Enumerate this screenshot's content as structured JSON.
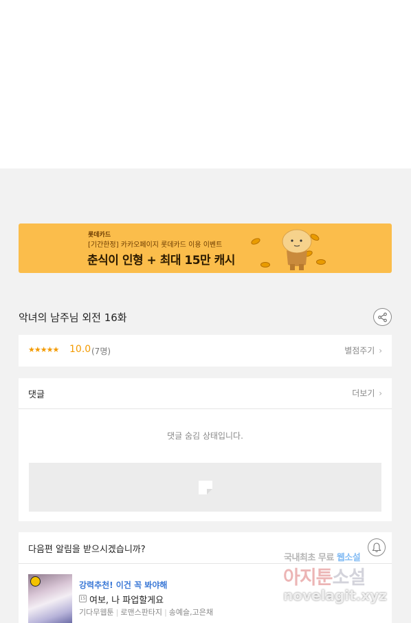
{
  "banner": {
    "brand": "롯데카드",
    "sub": "[기간한정] 카카오페이지 롯데카드 이용 이벤트",
    "headline": "춘식이 인형 + 최대 15만 캐시",
    "bg_color": "#fbbd4b"
  },
  "episode": {
    "title": "악녀의 남주님 외전 16화",
    "share_icon": "share-icon"
  },
  "rating": {
    "stars": "★★★★★",
    "score": "10.0",
    "count": "(7명)",
    "rate_link": "별점주기"
  },
  "comments": {
    "label": "댓글",
    "more": "더보기",
    "hidden_message": "댓글 숨김 상태입니다."
  },
  "notify": {
    "question": "다음편 알림을 받으시겠습니까?",
    "bell_icon": "bell-icon"
  },
  "recommendation": {
    "tag": "강력추천! 이건 꼭 봐야해",
    "age_badge": "15",
    "title": "여보, 나 파업할게요",
    "meta": [
      "기다무웹툰",
      "로맨스판타지",
      "송예슬,고은채"
    ]
  },
  "watermark": {
    "line1_a": "국내최초 무료 ",
    "line1_b": "웹소설",
    "line2_a": "아지툰",
    "line2_b": "소설",
    "line3": "novelagit.xyz"
  },
  "colors": {
    "accent_star": "#f39a00",
    "link_blue": "#3a78d6",
    "page_bg": "#f2f2f2"
  }
}
